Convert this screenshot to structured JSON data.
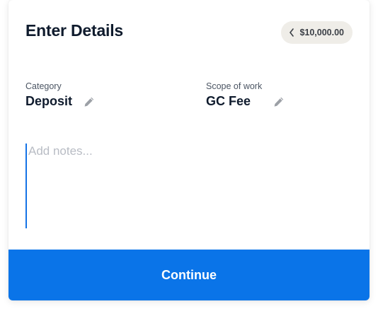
{
  "header": {
    "title": "Enter Details",
    "amount_badge": {
      "icon": "chevron-left-icon",
      "amount": "$10,000.00"
    }
  },
  "fields": {
    "category": {
      "label": "Category",
      "value": "Deposit",
      "edit_icon": "pencil-icon"
    },
    "scope": {
      "label": "Scope of work",
      "value": "GC Fee",
      "edit_icon": "pencil-icon"
    }
  },
  "notes": {
    "value": "",
    "placeholder": "Add notes..."
  },
  "footer": {
    "continue_label": "Continue"
  },
  "colors": {
    "primary": "#0a74e8",
    "title_text": "#0f1b2d",
    "badge_bg": "#efede8",
    "placeholder": "#b8bcc4"
  }
}
